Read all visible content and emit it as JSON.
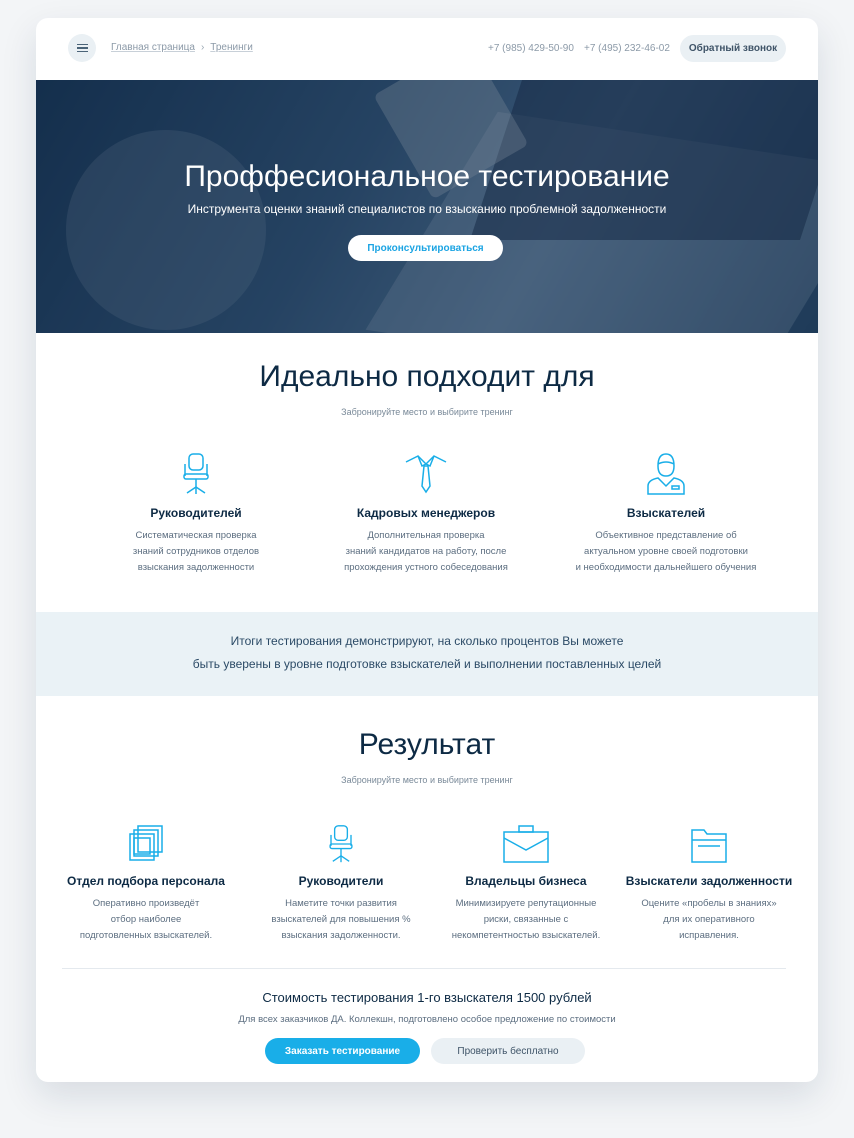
{
  "header": {
    "breadcrumb": [
      "Главная страница",
      "Тренинги"
    ],
    "phones": [
      "+7 (985) 429-50-90",
      "+7 (495) 232-46-02"
    ],
    "callback_label": "Обратный звонок"
  },
  "hero": {
    "title": "Проффесиональное тестирование",
    "subtitle": "Инструмента оценки знаний специалистов по взысканию проблемной задолженности",
    "button": "Проконсультироваться"
  },
  "ideal": {
    "title": "Идеально подходит для",
    "subtitle": "Забронируйте место и выбирите тренинг",
    "items": [
      {
        "icon": "office-chair-icon",
        "title": "Руководителей",
        "lines": [
          "Систематическая проверка",
          "знаний сотрудников отделов",
          "взыскания задолженности"
        ]
      },
      {
        "icon": "tie-icon",
        "title": "Кадровых менеджеров",
        "lines": [
          "Дополнительная проверка",
          "знаний кандидатов на работу, после",
          "прохождения устного собеседования"
        ]
      },
      {
        "icon": "employee-icon",
        "title": "Взыскателей",
        "lines": [
          "Объективное представление об",
          "актуальном уровне своей подготовки",
          "и необходимости дальнейшего обучения"
        ]
      }
    ]
  },
  "band": {
    "line1": "Итоги тестирования демонстрируют, на сколько процентов Вы можете",
    "line2": "быть уверены в уровне подготовке взыскателей и выполнении поставленных целей"
  },
  "result": {
    "title": "Результат",
    "subtitle": "Забронируйте место и выбирите тренинг",
    "items": [
      {
        "icon": "photos-icon",
        "title": "Отдел подбора персонала",
        "lines": [
          "Оперативно произведёт",
          "отбор наиболее",
          "подготовленных взыскателей."
        ]
      },
      {
        "icon": "office-chair-icon",
        "title": "Руководители",
        "lines": [
          "Наметите точки развития",
          "взыскателей для повышения %",
          "взыскания задолженности."
        ]
      },
      {
        "icon": "briefcase-icon",
        "title": "Владельцы бизнеса",
        "lines": [
          "Минимизируете репутационные",
          "риски, связанные с",
          "некомпетентностью взыскателей."
        ]
      },
      {
        "icon": "folder-icon",
        "title": "Взыскатели задолженности",
        "lines": [
          "Оцените «пробелы в знаниях»",
          "для их оперативного",
          "исправления."
        ]
      }
    ]
  },
  "pricing": {
    "title": "Стоимость тестирования 1-го взыскателя 1500 рублей",
    "subtitle": "Для всех заказчиков ДА. Коллекшн, подготовлено особое предложение по стоимости",
    "order_button": "Заказать тестирование",
    "free_button": "Проверить бесплатно"
  },
  "colors": {
    "accent": "#19aee8",
    "dark": "#0d2a44",
    "band": "#eaf2f6"
  }
}
